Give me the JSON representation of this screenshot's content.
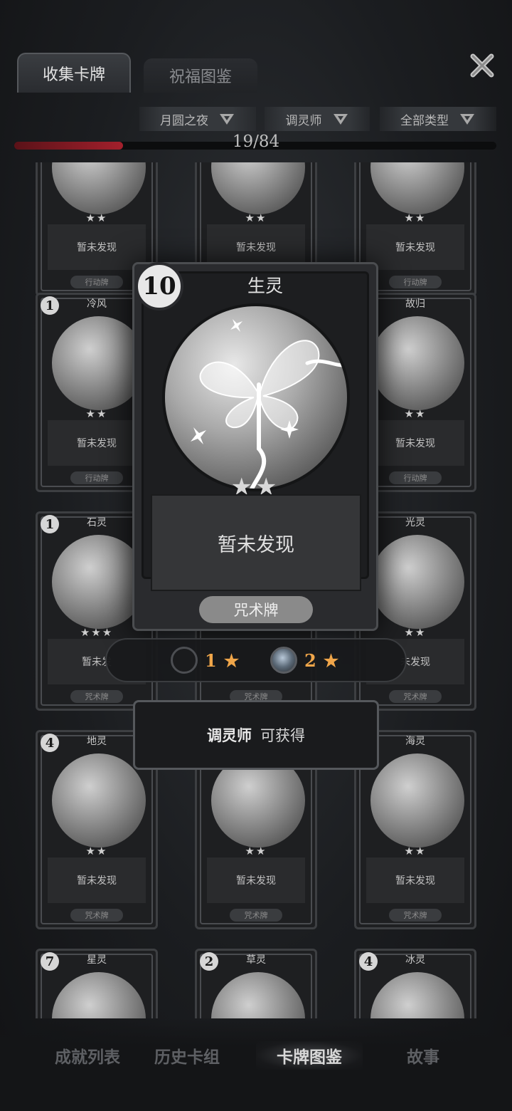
{
  "tabs": {
    "collect": "收集卡牌",
    "bless": "祝福图鉴"
  },
  "filters": [
    "月圆之夜",
    "调灵师",
    "全部类型"
  ],
  "progress": {
    "text": "19/84",
    "current": 19,
    "total": 84
  },
  "cards": [
    {
      "name": "",
      "cost": "",
      "stars": "★★",
      "desc": "暂未发现",
      "type": "行动牌"
    },
    {
      "name": "",
      "cost": "",
      "stars": "★★",
      "desc": "暂未发现",
      "type": "行动牌"
    },
    {
      "name": "",
      "cost": "",
      "stars": "★★",
      "desc": "暂未发现",
      "type": "行动牌"
    },
    {
      "name": "冷风",
      "cost": "1",
      "stars": "★★",
      "desc": "暂未发现",
      "type": "行动牌"
    },
    {
      "name": "",
      "cost": "",
      "stars": "",
      "desc": "",
      "type": ""
    },
    {
      "name": "故归",
      "cost": "",
      "stars": "★★",
      "desc": "暂未发现",
      "type": "行动牌"
    },
    {
      "name": "石灵",
      "cost": "1",
      "stars": "★★★",
      "desc": "暂未发",
      "type": "咒术牌"
    },
    {
      "name": "",
      "cost": "",
      "stars": "",
      "desc": "",
      "type": "咒术牌"
    },
    {
      "name": "光灵",
      "cost": "",
      "stars": "★★",
      "desc": "未发现",
      "type": "咒术牌"
    },
    {
      "name": "地灵",
      "cost": "4",
      "stars": "★★",
      "desc": "暂未发现",
      "type": "咒术牌"
    },
    {
      "name": "",
      "cost": "",
      "stars": "★★",
      "desc": "暂未发现",
      "type": "咒术牌"
    },
    {
      "name": "海灵",
      "cost": "2",
      "stars": "★★",
      "desc": "暂未发现",
      "type": "咒术牌"
    },
    {
      "name": "星灵",
      "cost": "7",
      "stars": "",
      "desc": "",
      "type": ""
    },
    {
      "name": "草灵",
      "cost": "2",
      "stars": "",
      "desc": "",
      "type": ""
    },
    {
      "name": "冰灵",
      "cost": "4",
      "stars": "",
      "desc": "",
      "type": ""
    }
  ],
  "popup": {
    "cost": "10",
    "name": "生灵",
    "stars": "★★",
    "desc": "暂未发现",
    "type": "咒术牌",
    "star_options": [
      {
        "count": "1",
        "icon": "★"
      },
      {
        "count": "2",
        "icon": "★"
      }
    ],
    "obtain": {
      "class_name": "调灵师",
      "text": "可获得"
    }
  },
  "nav": [
    "成就列表",
    "历史卡组",
    "卡牌图鉴",
    "故事"
  ],
  "colors": {
    "progress": "#a3202c",
    "star_gold": "#f0a64a"
  }
}
